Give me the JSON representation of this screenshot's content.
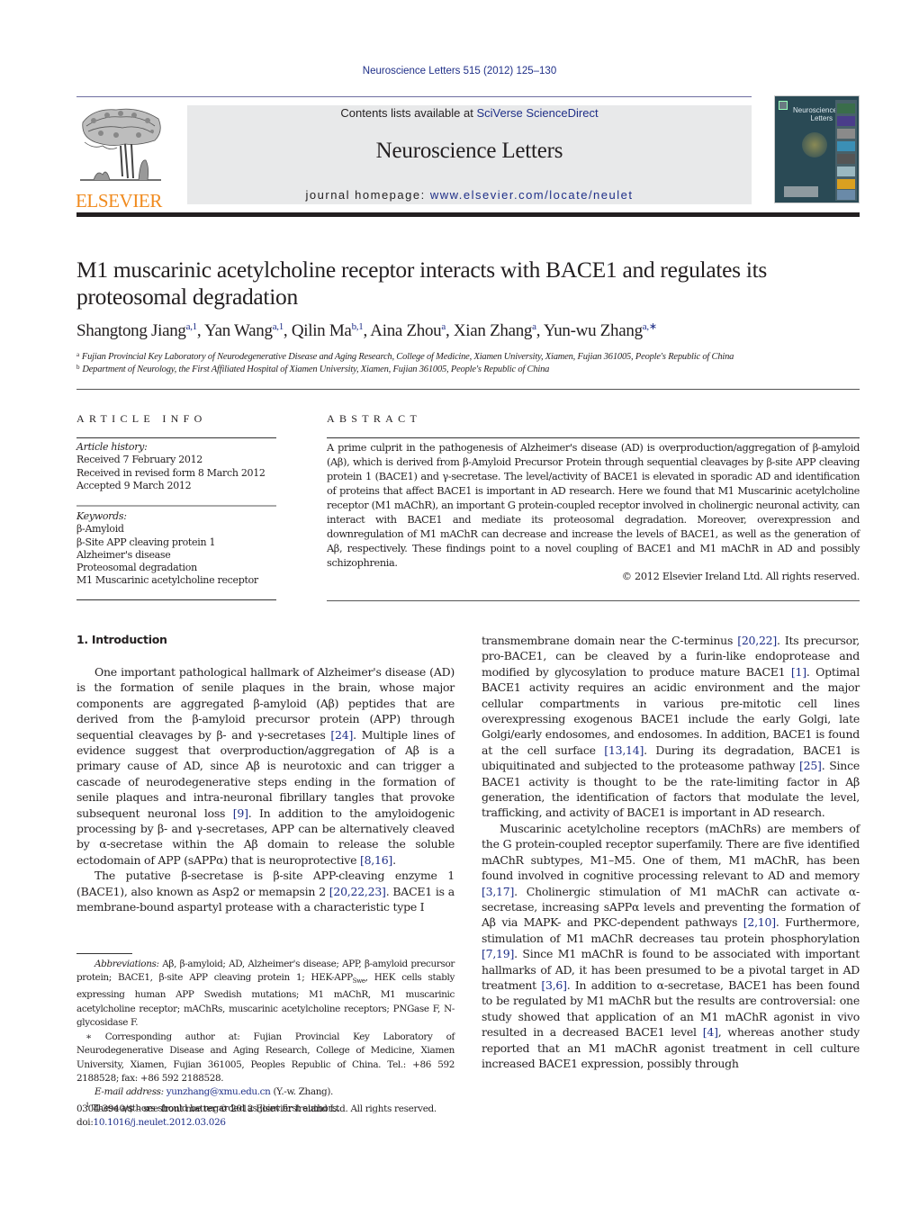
{
  "header": {
    "journal_ref": "Neuroscience Letters 515 (2012) 125–130",
    "contents_prefix": "Contents lists available at ",
    "contents_link": "SciVerse ScienceDirect",
    "journal_title": "Neuroscience Letters",
    "homepage_prefix": "journal homepage: ",
    "homepage_link": "www.elsevier.com/locate/neulet",
    "publisher_logo_text": "ELSEVIER",
    "cover_title_line1": "Neuroscience",
    "cover_title_line2": "Letters",
    "colors": {
      "link": "#1f2f88",
      "publisher_orange": "#f08a1d",
      "banner_bg": "#e8e9ea"
    }
  },
  "article": {
    "title": "M1 muscarinic acetylcholine receptor interacts with BACE1 and regulates its proteosomal degradation",
    "authors": [
      {
        "name": "Shangtong Jiang",
        "sup": "a,1"
      },
      {
        "name": "Yan Wang",
        "sup": "a,1"
      },
      {
        "name": "Qilin Ma",
        "sup": "b,1"
      },
      {
        "name": "Aina Zhou",
        "sup": "a"
      },
      {
        "name": "Xian Zhang",
        "sup": "a"
      },
      {
        "name": "Yun-wu Zhang",
        "sup": "a,∗"
      }
    ],
    "affiliations": [
      {
        "mark": "a",
        "text": "Fujian Provincial Key Laboratory of Neurodegenerative Disease and Aging Research, College of Medicine, Xiamen University, Xiamen, Fujian 361005, People's Republic of China"
      },
      {
        "mark": "b",
        "text": "Department of Neurology, the First Affiliated Hospital of Xiamen University, Xiamen, Fujian 361005, People's Republic of China"
      }
    ]
  },
  "article_info": {
    "heading": "ARTICLE INFO",
    "history_label": "Article history:",
    "history": [
      "Received 7 February 2012",
      "Received in revised form 8 March 2012",
      "Accepted 9 March 2012"
    ],
    "keywords_label": "Keywords:",
    "keywords": [
      "β-Amyloid",
      "β-Site APP cleaving protein 1",
      "Alzheimer's disease",
      "Proteosomal degradation",
      "M1 Muscarinic acetylcholine receptor"
    ]
  },
  "abstract": {
    "heading": "ABSTRACT",
    "text": "A prime culprit in the pathogenesis of Alzheimer's disease (AD) is overproduction/aggregation of β-amyloid (Aβ), which is derived from β-Amyloid Precursor Protein through sequential cleavages by β-site APP cleaving protein 1 (BACE1) and γ-secretase. The level/activity of BACE1 is elevated in sporadic AD and identification of proteins that affect BACE1 is important in AD research. Here we found that M1 Muscarinic acetylcholine receptor (M1 mAChR), an important G protein-coupled receptor involved in cholinergic neuronal activity, can interact with BACE1 and mediate its proteosomal degradation. Moreover, overexpression and downregulation of M1 mAChR can decrease and increase the levels of BACE1, as well as the generation of Aβ, respectively. These findings point to a novel coupling of BACE1 and M1 mAChR in AD and possibly schizophrenia.",
    "copyright": "© 2012 Elsevier Ireland Ltd. All rights reserved."
  },
  "body": {
    "section_heading": "1.  Introduction",
    "left_col": [
      [
        {
          "t": "One important pathological hallmark of Alzheimer's disease (AD) is the formation of senile plaques in the brain, whose major components are aggregated β-amyloid (Aβ) peptides that are derived from the β-amyloid precursor protein (APP) through sequential cleavages by β- and γ-secretases "
        },
        {
          "ref": "[24]"
        },
        {
          "t": ". Multiple lines of evidence suggest that overproduction/aggregation of Aβ is a primary cause of AD, since Aβ is neurotoxic and can trigger a cascade of neurodegenerative steps ending in the formation of senile plaques and intra-neuronal fibrillary tangles that provoke subsequent neuronal loss "
        },
        {
          "ref": "[9]"
        },
        {
          "t": ". In addition to the amyloidogenic processing by β- and γ-secretases, APP can be alternatively cleaved by α-secretase within the Aβ domain to release the soluble ectodomain of APP (sAPPα) that is neuroprotective "
        },
        {
          "ref": "[8,16]"
        },
        {
          "t": "."
        }
      ],
      [
        {
          "t": "The putative β-secretase is β-site APP-cleaving enzyme 1 (BACE1), also known as Asp2 or memapsin 2 "
        },
        {
          "ref": "[20,22,23]"
        },
        {
          "t": ". BACE1 is a membrane-bound aspartyl protease with a characteristic type I"
        }
      ]
    ],
    "right_col": [
      [
        {
          "t": "transmembrane domain near the C-terminus "
        },
        {
          "ref": "[20,22]"
        },
        {
          "t": ". Its precursor, pro-BACE1, can be cleaved by a furin-like endoprotease and modified by glycosylation to produce mature BACE1 "
        },
        {
          "ref": "[1]"
        },
        {
          "t": ". Optimal BACE1 activity requires an acidic environment and the major cellular compartments in various pre-mitotic cell lines overexpressing exogenous BACE1 include the early Golgi, late Golgi/early endosomes, and endosomes. In addition, BACE1 is found at the cell surface "
        },
        {
          "ref": "[13,14]"
        },
        {
          "t": ". During its degradation, BACE1 is ubiquitinated and subjected to the proteasome pathway "
        },
        {
          "ref": "[25]"
        },
        {
          "t": ". Since BACE1 activity is thought to be the rate-limiting factor in Aβ generation, the identification of factors that modulate the level, trafficking, and activity of BACE1 is important in AD research."
        }
      ],
      [
        {
          "t": "Muscarinic acetylcholine receptors (mAChRs) are members of the G protein-coupled receptor superfamily. There are five identified mAChR subtypes, M1–M5. One of them, M1 mAChR, has been found involved in cognitive processing relevant to AD and memory "
        },
        {
          "ref": "[3,17]"
        },
        {
          "t": ". Cholinergic stimulation of M1 mAChR can activate α-secretase, increasing sAPPα levels and preventing the formation of Aβ via MAPK- and PKC-dependent pathways "
        },
        {
          "ref": "[2,10]"
        },
        {
          "t": ". Furthermore, stimulation of M1 mAChR decreases tau protein phosphorylation "
        },
        {
          "ref": "[7,19]"
        },
        {
          "t": ". Since M1 mAChR is found to be associated with important hallmarks of AD, it has been presumed to be a pivotal target in AD treatment "
        },
        {
          "ref": "[3,6]"
        },
        {
          "t": ". In addition to α-secretase, BACE1 has been found to be regulated by M1 mAChR but the results are controversial: one study showed that application of an M1 mAChR agonist in vivo resulted in a decreased BACE1 level "
        },
        {
          "ref": "[4]"
        },
        {
          "t": ", whereas another study reported that an M1 mAChR agonist treatment in cell culture increased BACE1 expression, possibly through"
        }
      ]
    ]
  },
  "footnotes": {
    "abbrev_label": "Abbreviations:",
    "abbrev_text_1": " Aβ, β-amyloid; AD, Alzheimer's disease; APP, β-amyloid precursor protein; BACE1, β-site APP cleaving protein 1; HEK-APP",
    "abbrev_sub": "Swe",
    "abbrev_text_2": ", HEK cells stably expressing human APP Swedish mutations; M1 mAChR, M1 muscarinic acetylcholine receptor; mAChRs, muscarinic acetylcholine receptors; PNGase F, N-glycosidase F.",
    "corresponding": "∗ Corresponding author at: Fujian Provincial Key Laboratory of Neurodegenerative Disease and Aging Research, College of Medicine, Xiamen University, Xiamen, Fujian 361005, Peoples Republic of China. Tel.: +86 592 2188528; fax: +86 592 2188528.",
    "email_label": "E-mail address:",
    "email": "yunzhang@xmu.edu.cn",
    "email_suffix": " (Y.-w. Zhang).",
    "joint_mark": "1",
    "joint_text": " These authors should be regarded as joint first authors."
  },
  "legal": {
    "issn_line": "0304-3940/$ – see front matter © 2012 Elsevier Ireland Ltd. All rights reserved.",
    "doi_prefix": "doi:",
    "doi": "10.1016/j.neulet.2012.03.026"
  }
}
